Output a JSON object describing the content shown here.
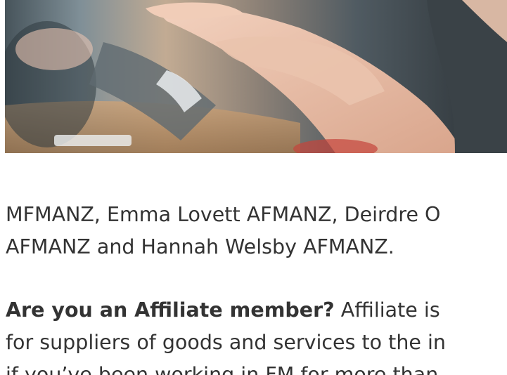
{
  "article": {
    "line1": "MFMANZ, Emma Lovett AFMANZ, Deirdre O",
    "line2": "AFMANZ and Hannah Welsby AFMANZ.",
    "question": "Are you an Affiliate member?",
    "line3_rest": " Affiliate is",
    "line4": "for suppliers of goods and services to the in",
    "line5": "if you’ve been working in FM for more than"
  },
  "colors": {
    "text": "#333333",
    "background": "#ffffff"
  }
}
